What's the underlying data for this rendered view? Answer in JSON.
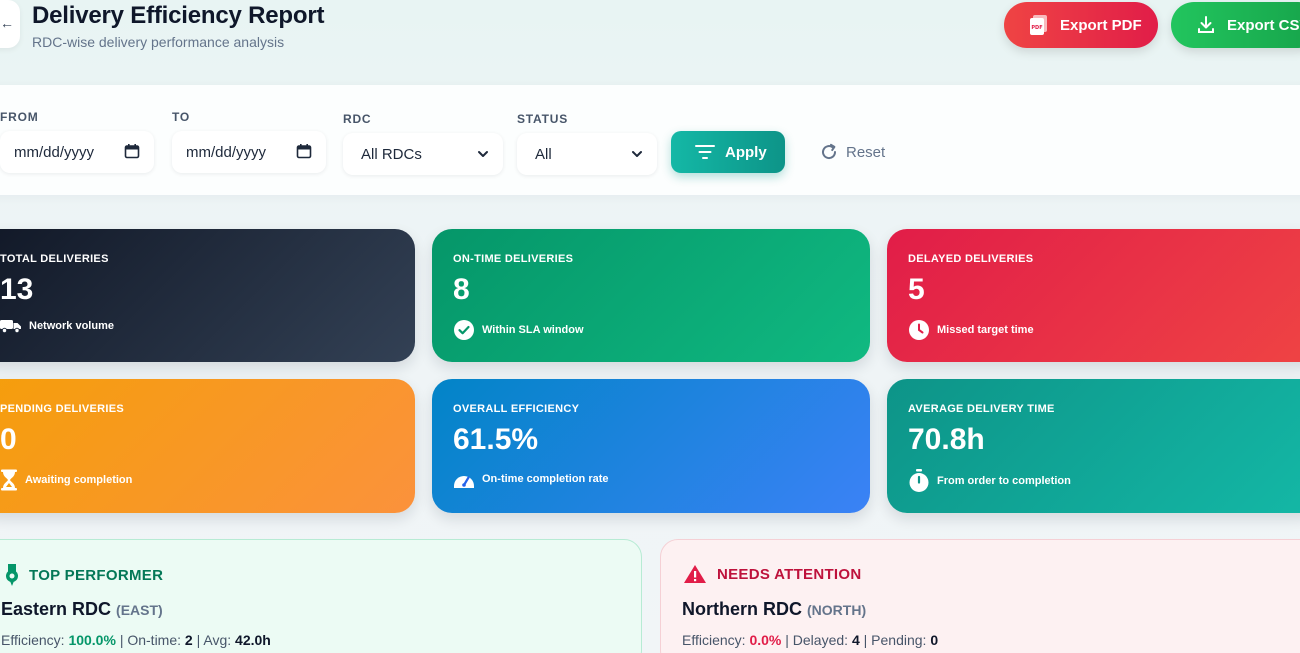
{
  "header": {
    "title": "Delivery Efficiency Report",
    "subtitle": "RDC-wise delivery performance analysis",
    "export_pdf": "Export PDF",
    "export_csv": "Export CSV"
  },
  "filters": {
    "from_label": "FROM",
    "from_value": "mm/dd/yyyy",
    "to_label": "TO",
    "to_value": "mm/dd/yyyy",
    "rdc_label": "RDC",
    "rdc_value": "All RDCs",
    "status_label": "STATUS",
    "status_value": "All",
    "apply": "Apply",
    "reset": "Reset"
  },
  "cards": [
    {
      "label": "TOTAL DELIVERIES",
      "value": "13",
      "note": "Network volume",
      "icon": "truck-icon"
    },
    {
      "label": "ON-TIME DELIVERIES",
      "value": "8",
      "note": "Within SLA window",
      "icon": "check-circle-icon"
    },
    {
      "label": "DELAYED DELIVERIES",
      "value": "5",
      "note": "Missed target time",
      "icon": "clock-icon"
    },
    {
      "label": "PENDING DELIVERIES",
      "value": "0",
      "note": "Awaiting completion",
      "icon": "hourglass-icon"
    },
    {
      "label": "OVERALL EFFICIENCY",
      "value": "61.5%",
      "note": "On-time completion rate",
      "icon": "gauge-icon"
    },
    {
      "label": "AVERAGE DELIVERY TIME",
      "value": "70.8h",
      "note": "From order to completion",
      "icon": "stopwatch-icon"
    }
  ],
  "top_performer": {
    "heading": "TOP PERFORMER",
    "name": "Eastern RDC",
    "code": "(EAST)",
    "efficiency_label": "Efficiency:",
    "efficiency_value": "100.0%",
    "ontime_label": "On-time:",
    "ontime_value": "2",
    "avg_label": "Avg:",
    "avg_value": "42.0h"
  },
  "needs_attention": {
    "heading": "NEEDS ATTENTION",
    "name": "Northern RDC",
    "code": "(NORTH)",
    "efficiency_label": "Efficiency:",
    "efficiency_value": "0.0%",
    "delayed_label": "Delayed:",
    "delayed_value": "4",
    "pending_label": "Pending:",
    "pending_value": "0"
  },
  "colors": {
    "teal_accent": "#0d9488",
    "green_text": "#059669",
    "red_text": "#e11d48"
  }
}
